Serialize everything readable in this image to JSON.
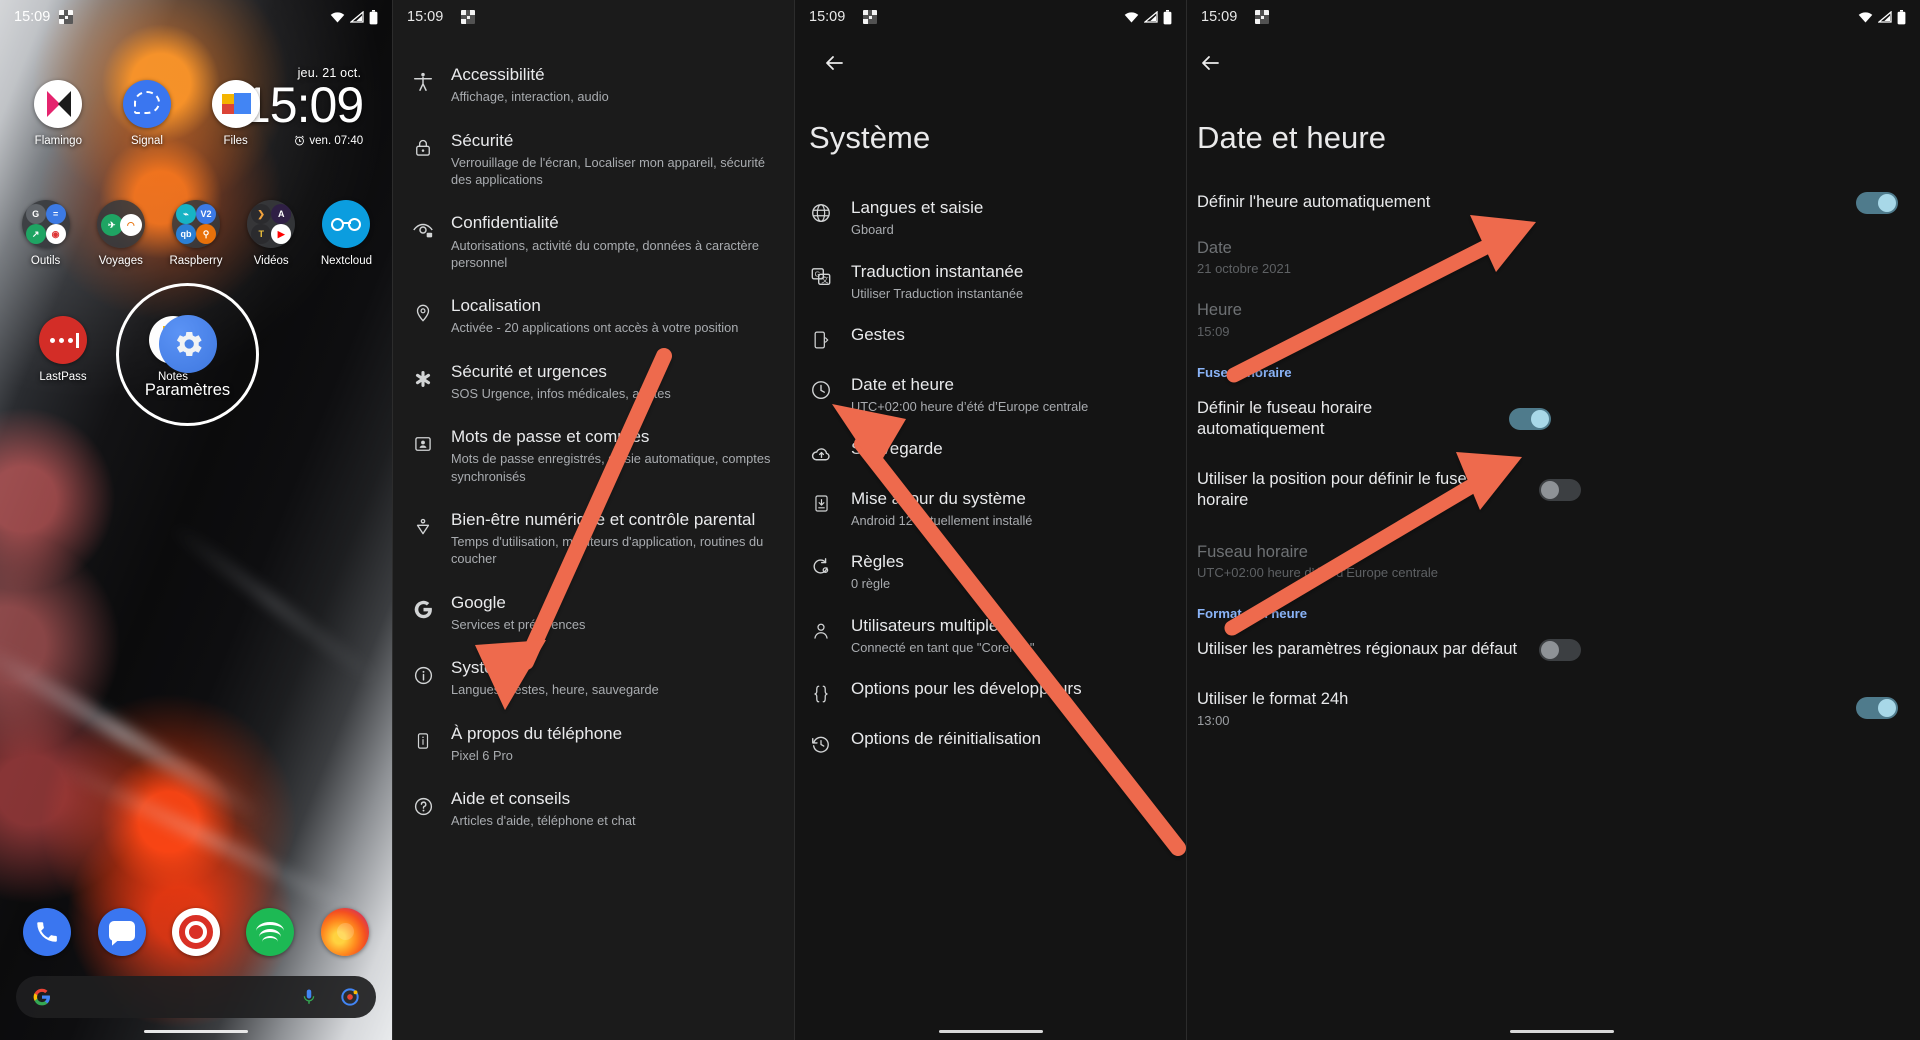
{
  "status_bar": {
    "time": "15:09",
    "icons": [
      "screenshot-icon",
      "wifi-icon",
      "signal-icon",
      "battery-icon"
    ]
  },
  "home": {
    "widget": {
      "date": "jeu. 21 oct.",
      "time": "15:09",
      "alarm": "ven. 07:40"
    },
    "row1": [
      {
        "label": "Flamingo",
        "icon": "flamingo-app-icon"
      },
      {
        "label": "Signal",
        "icon": "signal-app-icon"
      },
      {
        "label": "Files",
        "icon": "files-app-icon"
      }
    ],
    "row2": [
      {
        "label": "Outils",
        "icon": "folder-icon"
      },
      {
        "label": "Voyages",
        "icon": "folder-icon"
      },
      {
        "label": "Raspberry",
        "icon": "folder-icon"
      },
      {
        "label": "Vidéos",
        "icon": "folder-icon"
      },
      {
        "label": "Nextcloud",
        "icon": "nextcloud-app-icon"
      }
    ],
    "row3": [
      {
        "label": "LastPass",
        "icon": "lastpass-app-icon"
      },
      {
        "label": "Notes",
        "icon": "notes-app-icon"
      }
    ],
    "highlight": {
      "label": "Paramètres",
      "icon": "settings-gear-icon"
    },
    "dock": [
      {
        "label": "Téléphone",
        "icon": "phone-app-icon"
      },
      {
        "label": "Messages",
        "icon": "messages-app-icon"
      },
      {
        "label": "Navigateur",
        "icon": "browser-app-icon"
      },
      {
        "label": "Spotify",
        "icon": "spotify-app-icon"
      },
      {
        "label": "Firefox",
        "icon": "firefox-app-icon"
      }
    ],
    "search": {
      "placeholder": "",
      "icons": [
        "google-g-icon",
        "microphone-icon",
        "lens-icon"
      ]
    }
  },
  "settings_list": {
    "items": [
      {
        "icon": "accessibility-icon",
        "title": "Accessibilité",
        "subtitle": "Affichage, interaction, audio"
      },
      {
        "icon": "lock-icon",
        "title": "Sécurité",
        "subtitle": "Verrouillage de l'écran, Localiser mon appareil, sécurité des applications"
      },
      {
        "icon": "privacy-eye-icon",
        "title": "Confidentialité",
        "subtitle": "Autorisations, activité du compte, données à caractère personnel"
      },
      {
        "icon": "location-pin-icon",
        "title": "Localisation",
        "subtitle": "Activée - 20 applications ont accès à votre position"
      },
      {
        "icon": "emergency-asterisk-icon",
        "title": "Sécurité et urgences",
        "subtitle": "SOS Urgence, infos médicales, alertes"
      },
      {
        "icon": "passwords-account-icon",
        "title": "Mots de passe et comptes",
        "subtitle": "Mots de passe enregistrés, saisie automatique, comptes synchronisés"
      },
      {
        "icon": "digital-wellbeing-icon",
        "title": "Bien-être numérique et contrôle parental",
        "subtitle": "Temps d'utilisation, minuteurs d'application, routines du coucher"
      },
      {
        "icon": "google-g-icon",
        "title": "Google",
        "subtitle": "Services et préférences"
      },
      {
        "icon": "info-circle-icon",
        "title": "Système",
        "subtitle": "Langues, gestes, heure, sauvegarde"
      },
      {
        "icon": "phone-info-icon",
        "title": "À propos du téléphone",
        "subtitle": "Pixel 6 Pro"
      },
      {
        "icon": "help-circle-icon",
        "title": "Aide et conseils",
        "subtitle": "Articles d'aide, téléphone et chat"
      }
    ]
  },
  "system_screen": {
    "title": "Système",
    "back_icon": "back-arrow-icon",
    "items": [
      {
        "icon": "globe-icon",
        "title": "Langues et saisie",
        "subtitle": "Gboard"
      },
      {
        "icon": "translate-icon",
        "title": "Traduction instantanée",
        "subtitle": "Utiliser Traduction instantanée"
      },
      {
        "icon": "gestures-icon",
        "title": "Gestes",
        "subtitle": ""
      },
      {
        "icon": "clock-icon",
        "title": "Date et heure",
        "subtitle": "UTC+02:00 heure d’été d’Europe centrale"
      },
      {
        "icon": "backup-cloud-icon",
        "title": "Sauvegarde",
        "subtitle": ""
      },
      {
        "icon": "system-update-icon",
        "title": "Mise à jour du système",
        "subtitle": "Android 12 actuellement installé"
      },
      {
        "icon": "rules-icon",
        "title": "Règles",
        "subtitle": "0 règle"
      },
      {
        "icon": "person-icon",
        "title": "Utilisateurs multiples",
        "subtitle": "Connecté en tant que \"Corentin\""
      },
      {
        "icon": "braces-icon",
        "title": "Options pour les développeurs",
        "subtitle": ""
      },
      {
        "icon": "reset-history-icon",
        "title": "Options de réinitialisation",
        "subtitle": ""
      }
    ]
  },
  "datetime_screen": {
    "title": "Date et heure",
    "back_icon": "back-arrow-icon",
    "rows": [
      {
        "kind": "toggle",
        "title": "Définir l'heure automatiquement",
        "subtitle": "",
        "state": "on",
        "disabled": false
      },
      {
        "kind": "value",
        "title": "Date",
        "subtitle": "21 octobre 2021",
        "disabled": true
      },
      {
        "kind": "value",
        "title": "Heure",
        "subtitle": "15:09",
        "disabled": true
      }
    ],
    "section_timezone": "Fuseau horaire",
    "timezone_rows": [
      {
        "kind": "toggle",
        "title": "Définir le fuseau horaire automatiquement",
        "subtitle": "",
        "state": "on",
        "disabled": false
      },
      {
        "kind": "toggle",
        "title": "Utiliser la position pour définir le fuseau horaire",
        "subtitle": "",
        "state": "off",
        "disabled": false
      },
      {
        "kind": "value",
        "title": "Fuseau horaire",
        "subtitle": "UTC+02:00 heure d’été d’Europe centrale",
        "disabled": true
      }
    ],
    "section_format": "Format de l'heure",
    "format_rows": [
      {
        "kind": "toggle",
        "title": "Utiliser les paramètres régionaux par défaut",
        "subtitle": "",
        "state": "off",
        "disabled": false
      },
      {
        "kind": "toggle",
        "title": "Utiliser le format 24h",
        "subtitle": "13:00",
        "state": "on",
        "disabled": false
      }
    ]
  },
  "annotations": {
    "arrow_color": "#ee6a4d",
    "arrows": [
      {
        "name": "arrow-to-systeme"
      },
      {
        "name": "arrow-to-date-et-heure"
      },
      {
        "name": "arrow-to-auto-time-toggle"
      },
      {
        "name": "arrow-to-auto-timezone-toggle"
      }
    ]
  }
}
